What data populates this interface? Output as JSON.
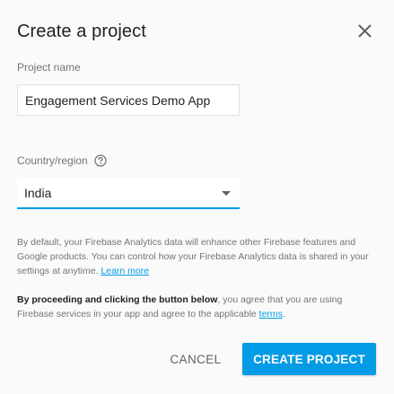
{
  "dialog": {
    "title": "Create a project",
    "close_icon": "close-icon"
  },
  "project_name": {
    "label": "Project name",
    "value": "Engagement Services Demo App"
  },
  "country": {
    "label": "Country/region",
    "help_icon": "help-circle-icon",
    "selected": "India"
  },
  "analytics_notice": {
    "text": "By default, your Firebase Analytics data will enhance other Firebase features and Google products. You can control how your Firebase Analytics data is shared in your settings at anytime.",
    "link": "Learn more"
  },
  "terms_notice": {
    "bold": "By proceeding and clicking the button below",
    "text": ", you agree that you are using Firebase services in your app and agree to the applicable ",
    "link": "terms",
    "end": "."
  },
  "buttons": {
    "cancel": "CANCEL",
    "create": "CREATE PROJECT"
  },
  "colors": {
    "accent": "#039be5",
    "background": "#fafafa",
    "text": "#212121",
    "secondary_text": "#757575"
  }
}
